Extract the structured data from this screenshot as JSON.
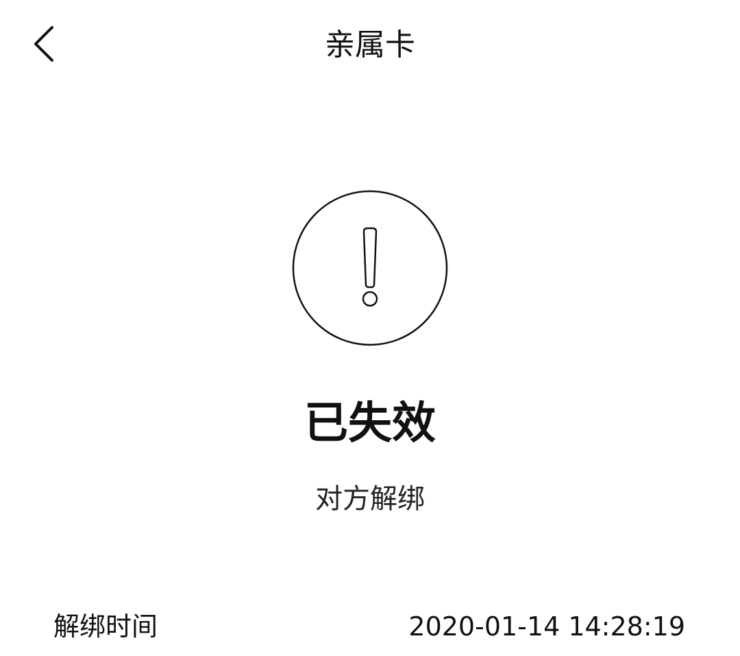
{
  "header": {
    "back_icon": "chevron-left-icon",
    "title": "亲属卡"
  },
  "status": {
    "icon": "exclamation-circle-icon",
    "title": "已失效",
    "subtitle": "对方解绑"
  },
  "details": {
    "unbind_time_label": "解绑时间",
    "unbind_time_value": "2020-01-14 14:28:19"
  }
}
